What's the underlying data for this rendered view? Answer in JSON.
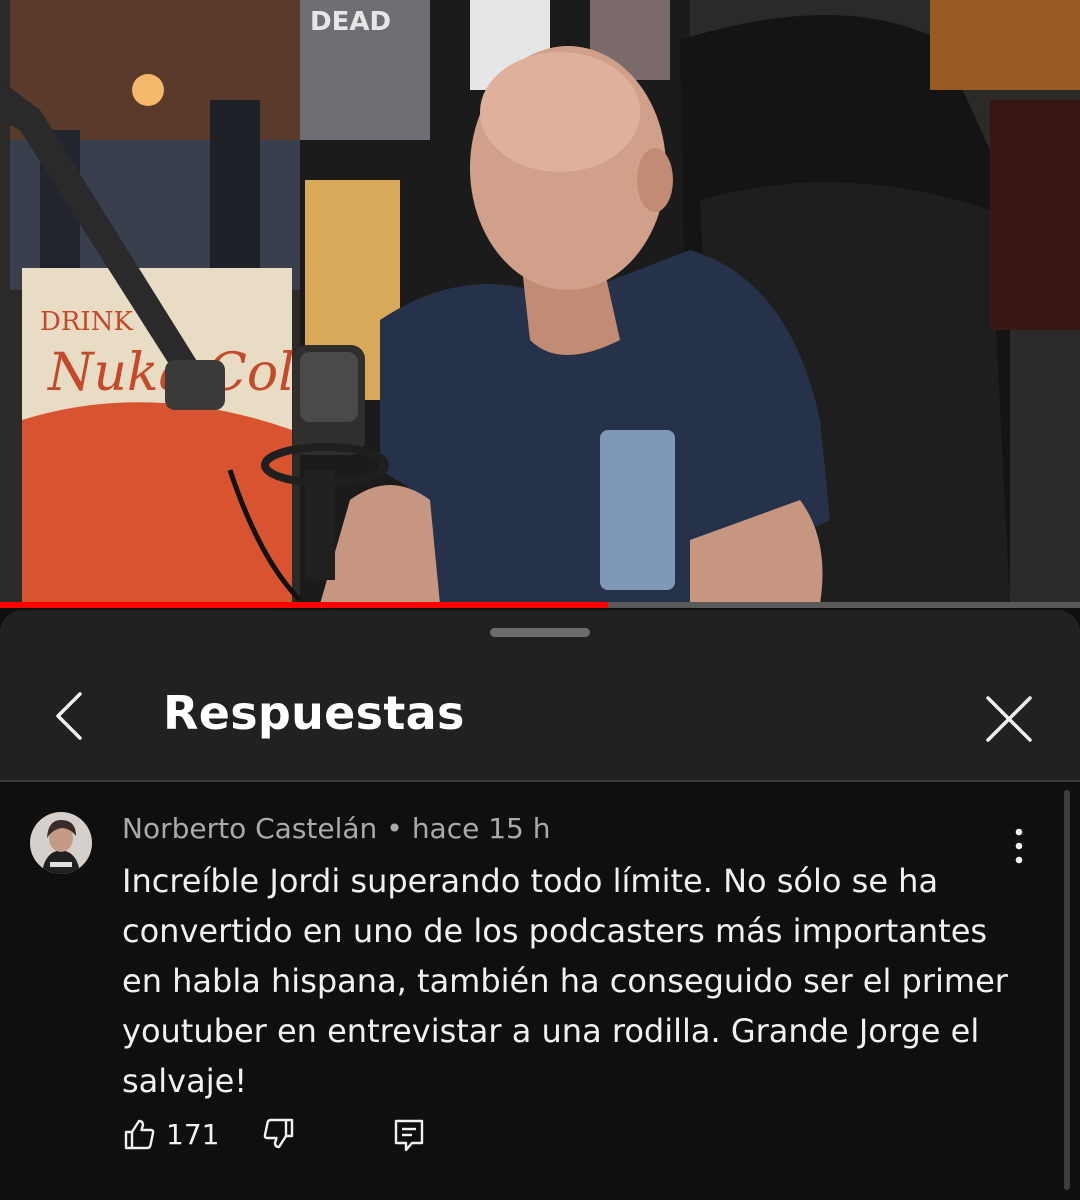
{
  "video": {
    "progress_fraction": 0.563,
    "accent_color": "#ff0000"
  },
  "sheet": {
    "title": "Respuestas",
    "back_icon": "chevron-left-icon",
    "close_icon": "close-icon"
  },
  "comment": {
    "author": "Norberto Castelán",
    "separator": "•",
    "time": "hace 15 h",
    "text": "Increíble Jordi superando todo límite. No sólo se ha convertido en uno de los podcasters más importantes en habla hispana, también ha conseguido ser el primer youtuber en entrevistar a una rodilla. Grande Jorge el salvaje!",
    "like_count": "171",
    "icons": [
      "thumbs-up-icon",
      "thumbs-down-icon",
      "reply-icon",
      "more-vert-icon"
    ]
  }
}
